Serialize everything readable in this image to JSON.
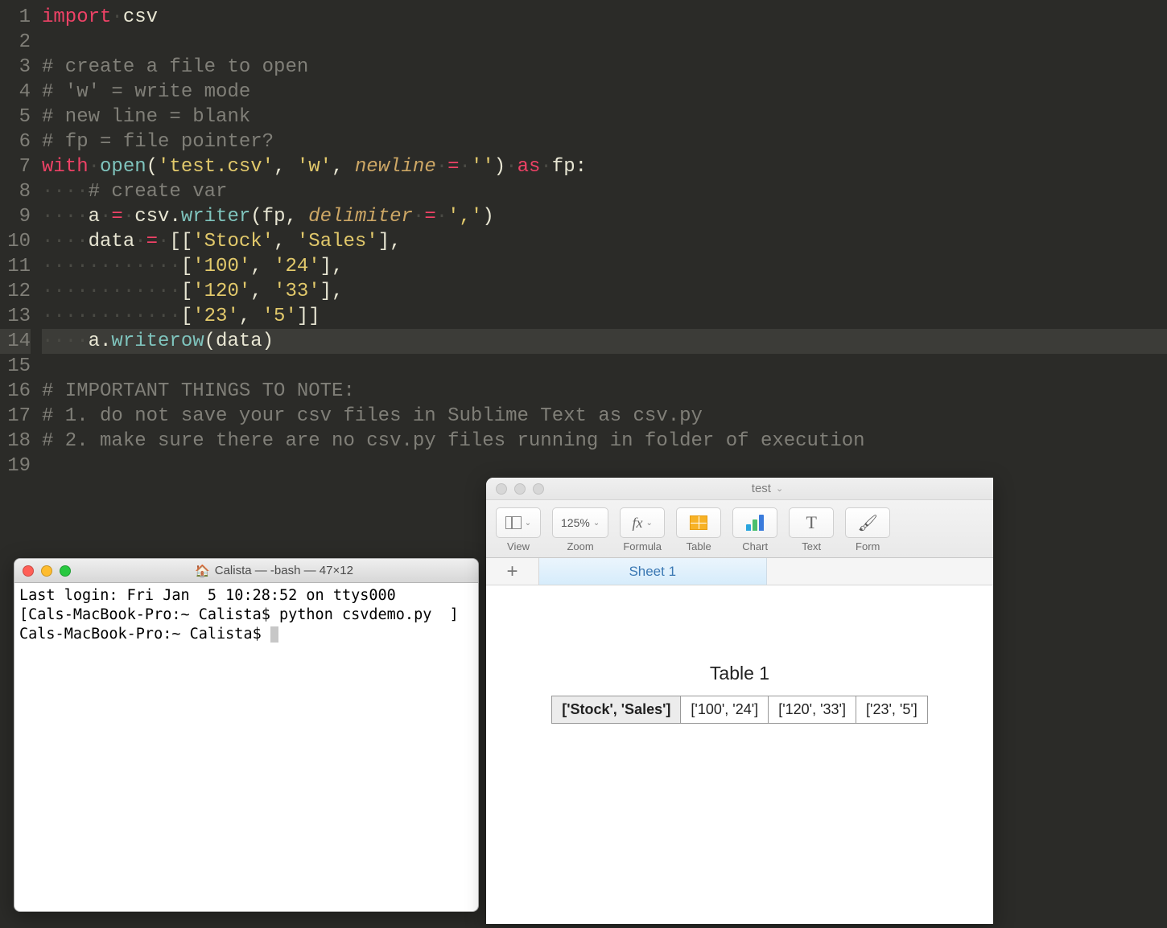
{
  "editor": {
    "line_count": 19,
    "highlight_line": 14,
    "tokens": [
      [
        {
          "t": "kw",
          "v": "import"
        },
        {
          "t": "ws",
          "v": "·"
        },
        {
          "t": "ident",
          "v": "csv"
        }
      ],
      [],
      [
        {
          "t": "cmt",
          "v": "# create a file to open"
        }
      ],
      [
        {
          "t": "cmt",
          "v": "# 'w' = write mode"
        }
      ],
      [
        {
          "t": "cmt",
          "v": "# new line = blank"
        }
      ],
      [
        {
          "t": "cmt",
          "v": "# fp = file pointer?"
        }
      ],
      [
        {
          "t": "kw",
          "v": "with"
        },
        {
          "t": "ws",
          "v": "·"
        },
        {
          "t": "fn",
          "v": "open"
        },
        {
          "t": "ident",
          "v": "("
        },
        {
          "t": "str",
          "v": "'test.csv'"
        },
        {
          "t": "ident",
          "v": ", "
        },
        {
          "t": "str",
          "v": "'w'"
        },
        {
          "t": "ident",
          "v": ", "
        },
        {
          "t": "named",
          "v": "newline"
        },
        {
          "t": "ws",
          "v": "·"
        },
        {
          "t": "op",
          "v": "="
        },
        {
          "t": "ws",
          "v": "·"
        },
        {
          "t": "str",
          "v": "''"
        },
        {
          "t": "ident",
          "v": ")"
        },
        {
          "t": "ws",
          "v": "·"
        },
        {
          "t": "kw",
          "v": "as"
        },
        {
          "t": "ws",
          "v": "·"
        },
        {
          "t": "ident",
          "v": "fp:"
        }
      ],
      [
        {
          "t": "ws",
          "v": "····"
        },
        {
          "t": "cmt",
          "v": "# create var"
        }
      ],
      [
        {
          "t": "ws",
          "v": "····"
        },
        {
          "t": "ident",
          "v": "a"
        },
        {
          "t": "ws",
          "v": "·"
        },
        {
          "t": "op",
          "v": "="
        },
        {
          "t": "ws",
          "v": "·"
        },
        {
          "t": "ident",
          "v": "csv."
        },
        {
          "t": "fn",
          "v": "writer"
        },
        {
          "t": "ident",
          "v": "(fp, "
        },
        {
          "t": "named",
          "v": "delimiter"
        },
        {
          "t": "ws",
          "v": "·"
        },
        {
          "t": "op",
          "v": "="
        },
        {
          "t": "ws",
          "v": "·"
        },
        {
          "t": "str",
          "v": "','"
        },
        {
          "t": "ident",
          "v": ")"
        }
      ],
      [
        {
          "t": "ws",
          "v": "····"
        },
        {
          "t": "ident",
          "v": "data"
        },
        {
          "t": "ws",
          "v": "·"
        },
        {
          "t": "op",
          "v": "="
        },
        {
          "t": "ws",
          "v": "·"
        },
        {
          "t": "ident",
          "v": "[["
        },
        {
          "t": "str",
          "v": "'Stock'"
        },
        {
          "t": "ident",
          "v": ", "
        },
        {
          "t": "str",
          "v": "'Sales'"
        },
        {
          "t": "ident",
          "v": "],"
        }
      ],
      [
        {
          "t": "ws",
          "v": "············"
        },
        {
          "t": "ident",
          "v": "["
        },
        {
          "t": "str",
          "v": "'100'"
        },
        {
          "t": "ident",
          "v": ", "
        },
        {
          "t": "str",
          "v": "'24'"
        },
        {
          "t": "ident",
          "v": "],"
        }
      ],
      [
        {
          "t": "ws",
          "v": "············"
        },
        {
          "t": "ident",
          "v": "["
        },
        {
          "t": "str",
          "v": "'120'"
        },
        {
          "t": "ident",
          "v": ", "
        },
        {
          "t": "str",
          "v": "'33'"
        },
        {
          "t": "ident",
          "v": "],"
        }
      ],
      [
        {
          "t": "ws",
          "v": "············"
        },
        {
          "t": "ident",
          "v": "["
        },
        {
          "t": "str",
          "v": "'23'"
        },
        {
          "t": "ident",
          "v": ", "
        },
        {
          "t": "str",
          "v": "'5'"
        },
        {
          "t": "ident",
          "v": "]]"
        }
      ],
      [
        {
          "t": "ws",
          "v": "····"
        },
        {
          "t": "ident",
          "v": "a."
        },
        {
          "t": "fn",
          "v": "writerow"
        },
        {
          "t": "ident",
          "v": "(data)"
        }
      ],
      [],
      [
        {
          "t": "cmt",
          "v": "# IMPORTANT THINGS TO NOTE:"
        }
      ],
      [
        {
          "t": "cmt",
          "v": "# 1. do not save your csv files in Sublime Text as csv.py"
        }
      ],
      [
        {
          "t": "cmt",
          "v": "# 2. make sure there are no csv.py files running in folder of execution"
        }
      ],
      []
    ]
  },
  "terminal": {
    "title": "Calista — -bash — 47×12",
    "lines": [
      "Last login: Fri Jan  5 10:28:52 on ttys000",
      "[Cals-MacBook-Pro:~ Calista$ python csvdemo.py  ]",
      "Cals-MacBook-Pro:~ Calista$ "
    ]
  },
  "numbers": {
    "title": "test",
    "toolbar": {
      "view": "View",
      "zoom_value": "125%",
      "zoom": "Zoom",
      "formula": "Formula",
      "table": "Table",
      "chart": "Chart",
      "text": "Text",
      "format": "Form"
    },
    "sheet_tab": "Sheet 1",
    "table_title": "Table 1",
    "table_cells": [
      "['Stock', 'Sales']",
      "['100', '24']",
      "['120', '33']",
      "['23', '5']"
    ]
  }
}
